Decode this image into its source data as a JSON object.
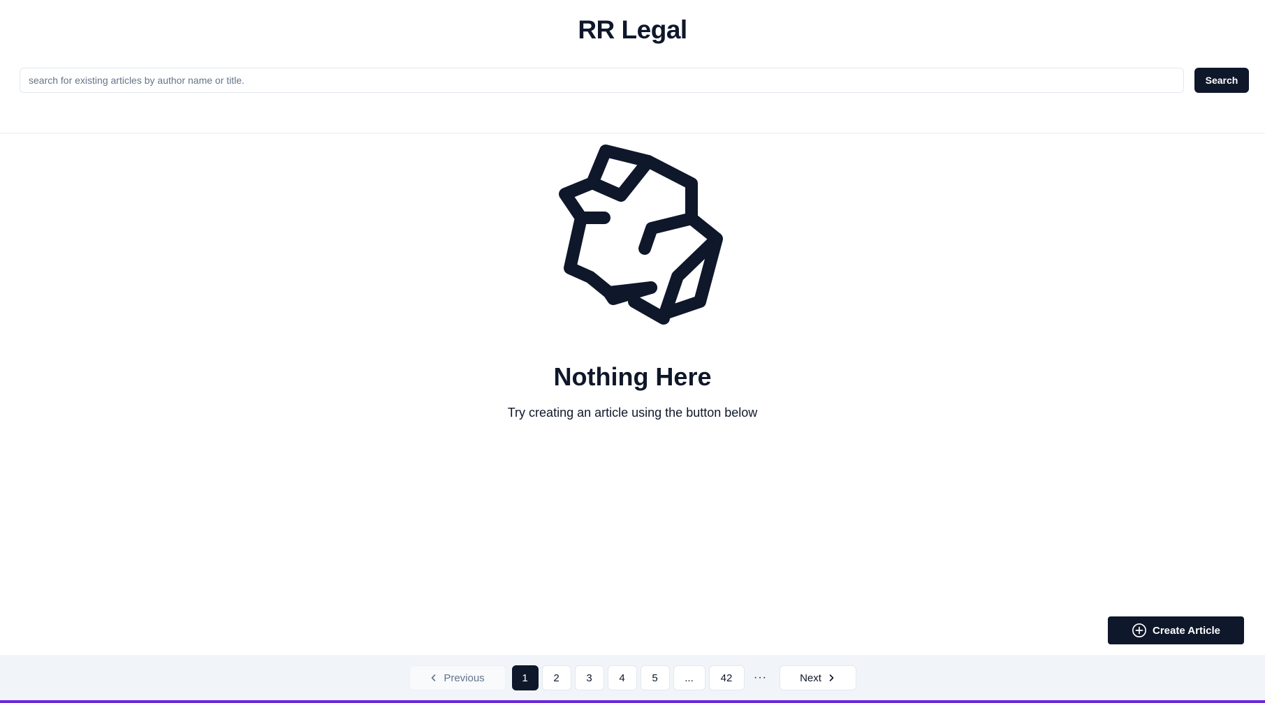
{
  "header": {
    "title": "RR Legal",
    "search_placeholder": "search for existing articles by author name or title.",
    "search_value": "",
    "search_button": "Search"
  },
  "empty_state": {
    "icon": "crumpled-paper-icon",
    "title": "Nothing Here",
    "subtitle": "Try creating an article using the button below"
  },
  "actions": {
    "create_label": "Create Article",
    "create_icon": "plus-circle-icon"
  },
  "pagination": {
    "previous_label": "Previous",
    "next_label": "Next",
    "pages": [
      "1",
      "2",
      "3",
      "4",
      "5",
      "...",
      "42"
    ],
    "current_page": "1",
    "more_dots": "···"
  },
  "colors": {
    "primary": "#0f172a",
    "footer_bg": "#f1f5f9",
    "accent_border": "#6d28d9"
  }
}
